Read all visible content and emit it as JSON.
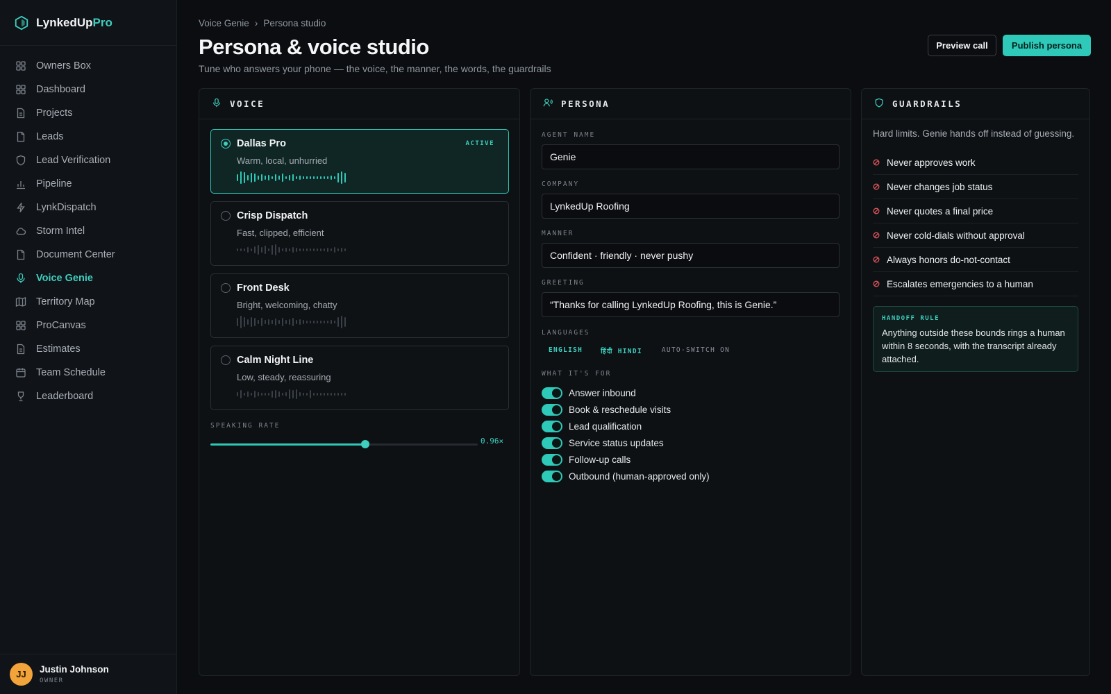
{
  "brand": {
    "name_main": "LynkedUp",
    "name_accent": "Pro"
  },
  "sidebar": {
    "items": [
      {
        "label": "Owners Box",
        "icon": "grid-icon"
      },
      {
        "label": "Dashboard",
        "icon": "grid-icon"
      },
      {
        "label": "Projects",
        "icon": "document-icon"
      },
      {
        "label": "Leads",
        "icon": "file-icon"
      },
      {
        "label": "Lead Verification",
        "icon": "shield-icon"
      },
      {
        "label": "Pipeline",
        "icon": "bar-chart-icon"
      },
      {
        "label": "LynkDispatch",
        "icon": "lightning-icon"
      },
      {
        "label": "Storm Intel",
        "icon": "cloud-icon"
      },
      {
        "label": "Document Center",
        "icon": "file-icon"
      },
      {
        "label": "Voice Genie",
        "icon": "microphone-icon",
        "active": true
      },
      {
        "label": "Territory Map",
        "icon": "map-icon"
      },
      {
        "label": "ProCanvas",
        "icon": "grid-icon"
      },
      {
        "label": "Estimates",
        "icon": "document-icon"
      },
      {
        "label": "Team Schedule",
        "icon": "calendar-icon"
      },
      {
        "label": "Leaderboard",
        "icon": "trophy-icon"
      }
    ]
  },
  "user": {
    "initials": "JJ",
    "name": "Justin Johnson",
    "role": "OWNER"
  },
  "header": {
    "breadcrumb": [
      "Voice Genie",
      "Persona studio"
    ],
    "breadcrumb_sep": "›",
    "title": "Persona & voice studio",
    "subtitle": "Tune who answers your phone — the voice, the manner, the words, the guardrails",
    "preview_label": "Preview call",
    "publish_label": "Publish persona"
  },
  "voice": {
    "title": "VOICE",
    "active_badge": "ACTIVE",
    "options": [
      {
        "name": "Dallas Pro",
        "desc": "Warm, local, unhurried",
        "active": true
      },
      {
        "name": "Crisp Dispatch",
        "desc": "Fast, clipped, efficient",
        "active": false
      },
      {
        "name": "Front Desk",
        "desc": "Bright, welcoming, chatty",
        "active": false
      },
      {
        "name": "Calm Night Line",
        "desc": "Low, steady, reassuring",
        "active": false
      }
    ],
    "rate_label": "SPEAKING RATE",
    "rate_value": "0.96×",
    "rate_fraction": 0.58
  },
  "persona": {
    "title": "PERSONA",
    "agent_name_label": "AGENT NAME",
    "agent_name": "Genie",
    "company_label": "COMPANY",
    "company": "LynkedUp Roofing",
    "manner_label": "MANNER",
    "manner": "Confident · friendly · never pushy",
    "greeting_label": "GREETING",
    "greeting": "“Thanks for calling LynkedUp Roofing, this is Genie.”",
    "languages_label": "LANGUAGES",
    "languages": [
      "ENGLISH",
      "हिंदी HINDI",
      "AUTO-SWITCH ON"
    ],
    "uses_label": "WHAT IT'S FOR",
    "uses": [
      "Answer inbound",
      "Book & reschedule visits",
      "Lead qualification",
      "Service status updates",
      "Follow-up calls",
      "Outbound (human-approved only)"
    ]
  },
  "guardrails": {
    "title": "GUARDRAILS",
    "intro": "Hard limits. Genie hands off instead of guessing.",
    "rules": [
      "Never approves work",
      "Never changes job status",
      "Never quotes a final price",
      "Never cold-dials without approval",
      "Always honors do-not-contact",
      "Escalates emergencies to a human"
    ],
    "handoff_label": "HANDOFF RULE",
    "handoff_text": "Anything outside these bounds rings a human within 8 seconds, with the transcript already attached."
  },
  "colors": {
    "accent": "#2ec9b8",
    "background": "#0b0d10",
    "danger": "#e0555b",
    "avatar": "#f2a33a"
  }
}
